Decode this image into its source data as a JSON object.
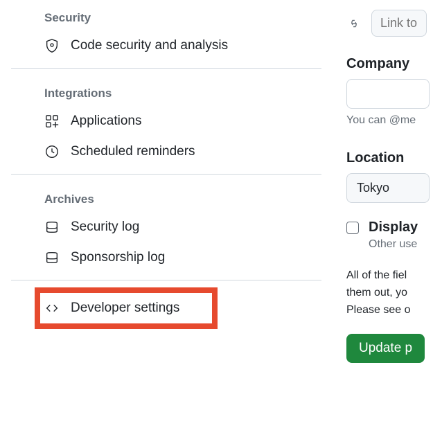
{
  "sidebar": {
    "sections": [
      {
        "header": "Security",
        "items": [
          {
            "label": "Code security and analysis"
          }
        ]
      },
      {
        "header": "Integrations",
        "items": [
          {
            "label": "Applications"
          },
          {
            "label": "Scheduled reminders"
          }
        ]
      },
      {
        "header": "Archives",
        "items": [
          {
            "label": "Security log"
          },
          {
            "label": "Sponsorship log"
          }
        ]
      }
    ],
    "developer_settings": "Developer settings"
  },
  "main": {
    "link_placeholder": "Link to",
    "company_label": "Company",
    "company_value": "",
    "company_helper": "You can @me",
    "location_label": "Location",
    "location_value": "Tokyo",
    "display_label": "Display",
    "display_sub": "Other use",
    "body_text": "All of the fiel\nthem out, yo\nPlease see o",
    "update_button": "Update p"
  }
}
